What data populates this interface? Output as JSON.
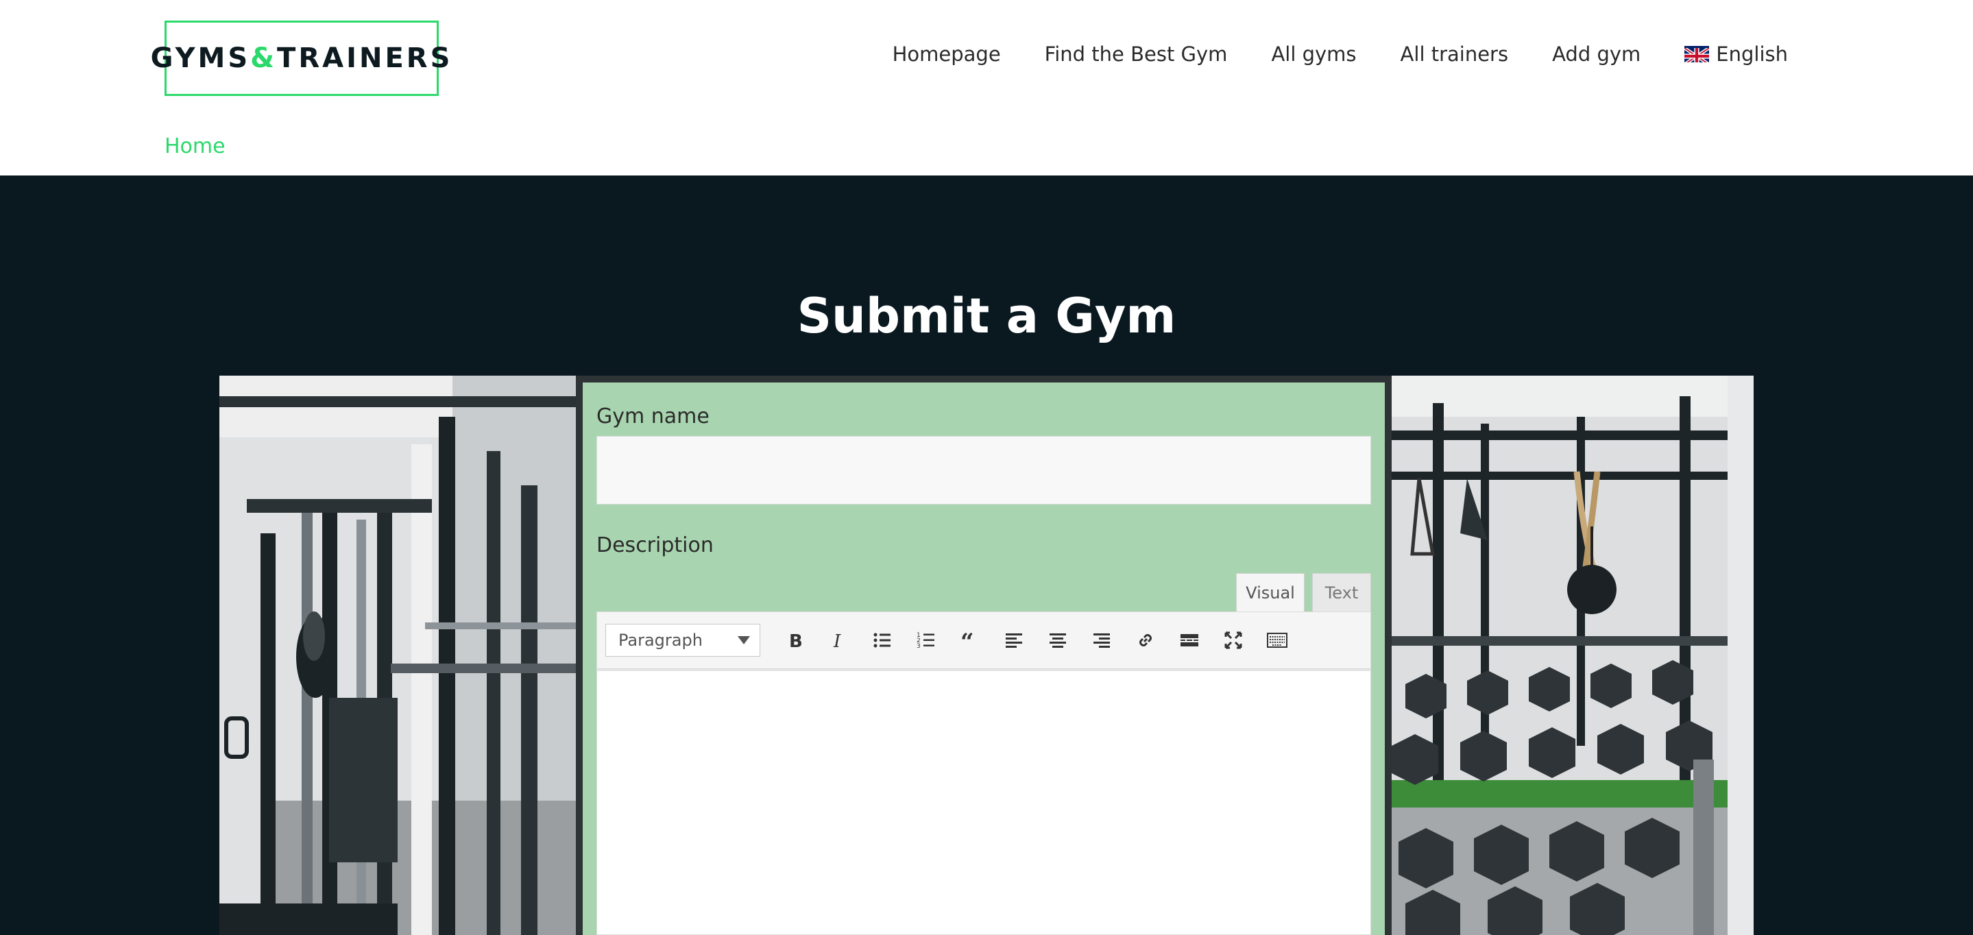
{
  "header": {
    "logo": {
      "part1": "GYMS",
      "amp": "&",
      "part2": "TRAINERS"
    },
    "nav": [
      "Homepage",
      "Find the Best Gym",
      "All gyms",
      "All trainers",
      "Add gym"
    ],
    "language": "English",
    "breadcrumb": "Home"
  },
  "main": {
    "title": "Submit a Gym",
    "form": {
      "gym_name_label": "Gym name",
      "gym_name_value": "",
      "description_label": "Description",
      "tabs": [
        "Visual",
        "Text"
      ],
      "format_select": "Paragraph",
      "toolbar_icons": [
        "bold-icon",
        "italic-icon",
        "bulleted-list-icon",
        "numbered-list-icon",
        "blockquote-icon",
        "align-left-icon",
        "align-center-icon",
        "align-right-icon",
        "link-icon",
        "read-more-icon",
        "fullscreen-icon",
        "toolbar-toggle-icon"
      ]
    }
  },
  "colors": {
    "accent": "#2bd96b",
    "dark_bg": "#0a1820",
    "form_bg": "#a8d5b0"
  }
}
